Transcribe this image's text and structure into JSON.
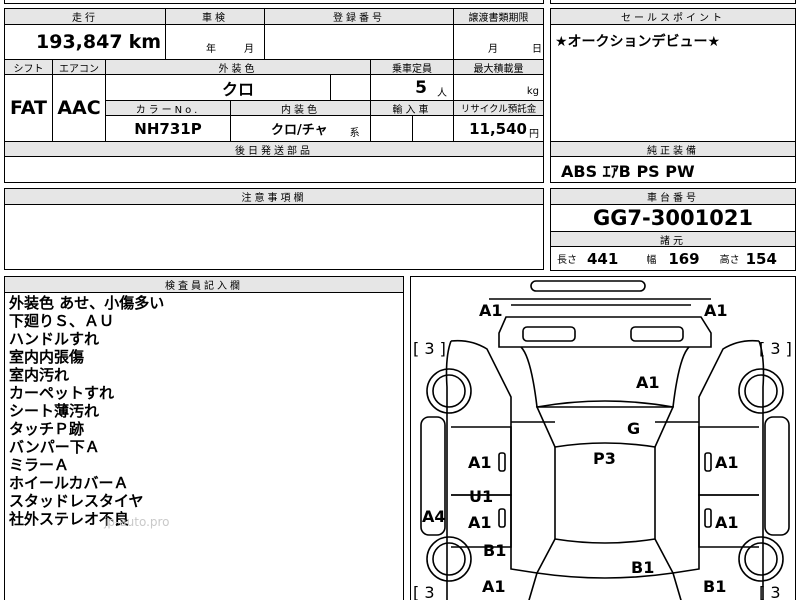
{
  "header": {
    "mileage_label": "走行",
    "mileage_value": "193,847",
    "mileage_unit": "km",
    "inspection_label": "車検",
    "inspection_year_unit": "年",
    "inspection_month_unit": "月",
    "registration_label": "登録番号",
    "transfer_deadline_label": "譲渡書類期限",
    "transfer_month_unit": "月",
    "transfer_day_unit": "日"
  },
  "spec": {
    "shift_label": "シフト",
    "shift_value": "FAT",
    "aircon_label": "エアコン",
    "aircon_value": "AAC",
    "exterior_color_label": "外装色",
    "exterior_color_value": "クロ",
    "capacity_label": "乗車定員",
    "capacity_value": "5",
    "capacity_unit": "人",
    "max_load_label": "最大積載量",
    "max_load_unit": "kg",
    "color_no_label": "カラーNo.",
    "color_no_value": "NH731P",
    "interior_color_label": "内装色",
    "interior_color_value": "クロ/チャ",
    "interior_color_suffix": "系",
    "import_label": "輸入車",
    "recycle_label": "リサイクル預託金",
    "recycle_value": "11,540",
    "recycle_unit": "円",
    "later_parts_label": "後日発送部品"
  },
  "sales_point": {
    "label": "セールスポイント",
    "text": "★オークションデビュー★"
  },
  "equipment": {
    "label": "純正装備",
    "value": "ABS ｴｱB PS PW"
  },
  "caution": {
    "label": "注意事項欄"
  },
  "chassis": {
    "label": "車台番号",
    "value": "GG7-3001021",
    "dims_label": "諸元",
    "length_label": "長さ",
    "length_value": "441",
    "width_label": "幅",
    "width_value": "169",
    "height_label": "高さ",
    "height_value": "154"
  },
  "inspector": {
    "label": "検査員記入欄",
    "notes": [
      "外装色 あせ、小傷多い",
      "下廻りＳ、ＡＵ",
      "ハンドルすれ",
      "室内内張傷",
      "室内汚れ",
      "カーペットすれ",
      "シート薄汚れ",
      "タッチＰ跡",
      "バンパー下Ａ",
      "ミラーＡ",
      "ホイールカバーＡ",
      "スタッドレスタイヤ",
      "社外ステレオ不良"
    ],
    "watermark": "jp-auto.pro"
  },
  "diagram": {
    "labels": {
      "front_left": "A1",
      "front_right": "A1",
      "tire_front_left": "[ 3 ]",
      "tire_front_right": "[ 3 ]",
      "hood": "A1",
      "windshield": "G",
      "roof": "P3",
      "door_fl": "A1",
      "door_fr": "A1",
      "door_rl_upper": "U1",
      "door_rl": "A1",
      "door_rr": "A1",
      "side_left": "A4",
      "quarter_left": "B1",
      "rear_center": "B1",
      "rear_left": "A1",
      "rear_right": "B1",
      "tire_rear_left": "[ 3",
      "tire_rear_right": "[ 3"
    }
  }
}
